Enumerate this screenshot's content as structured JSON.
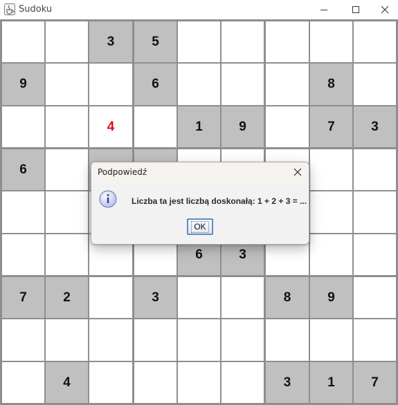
{
  "window": {
    "title": "Sudoku",
    "icons": {
      "app": "java-cup-icon",
      "minimize": "minimize-icon",
      "maximize": "maximize-icon",
      "close": "close-icon"
    }
  },
  "board": {
    "rows": [
      [
        "",
        "",
        "3",
        "5",
        "",
        "",
        "",
        "",
        ""
      ],
      [
        "9",
        "",
        "",
        "6",
        "",
        "",
        "",
        "8",
        ""
      ],
      [
        "",
        "",
        "4",
        "",
        "1",
        "9",
        "",
        "7",
        "3"
      ],
      [
        "6",
        "",
        "",
        "",
        "",
        "",
        "",
        "",
        ""
      ],
      [
        "",
        "",
        "",
        "",
        "",
        "",
        "",
        "",
        ""
      ],
      [
        "",
        "",
        "",
        "",
        "6",
        "3",
        "",
        "",
        ""
      ],
      [
        "7",
        "2",
        "",
        "3",
        "",
        "",
        "8",
        "9",
        ""
      ],
      [
        "",
        "",
        "",
        "",
        "",
        "",
        "",
        "",
        ""
      ],
      [
        "",
        "4",
        "",
        "",
        "",
        "",
        "3",
        "1",
        "7"
      ]
    ],
    "given": [
      [
        0,
        0,
        1,
        1,
        0,
        0,
        0,
        0,
        0
      ],
      [
        1,
        0,
        0,
        1,
        0,
        0,
        0,
        1,
        0
      ],
      [
        0,
        0,
        0,
        0,
        1,
        1,
        0,
        1,
        1
      ],
      [
        1,
        0,
        1,
        1,
        0,
        0,
        0,
        0,
        0
      ],
      [
        0,
        0,
        0,
        0,
        0,
        0,
        0,
        0,
        0
      ],
      [
        0,
        0,
        0,
        0,
        1,
        1,
        0,
        0,
        0
      ],
      [
        1,
        1,
        0,
        1,
        0,
        0,
        1,
        1,
        0
      ],
      [
        0,
        0,
        0,
        0,
        0,
        0,
        0,
        0,
        0
      ],
      [
        0,
        1,
        0,
        0,
        0,
        0,
        1,
        1,
        1
      ]
    ],
    "user_entry_color": "#e0101c",
    "given_cell_color": "#c0c0c0",
    "empty_cell_color": "#ffffff"
  },
  "dialog": {
    "title": "Podpowiedź",
    "message": "Liczba ta jest liczbą doskonałą: 1 + 2 + 3 = ...",
    "ok_label": "OK",
    "icons": {
      "info": "info-icon",
      "close": "close-icon"
    }
  }
}
